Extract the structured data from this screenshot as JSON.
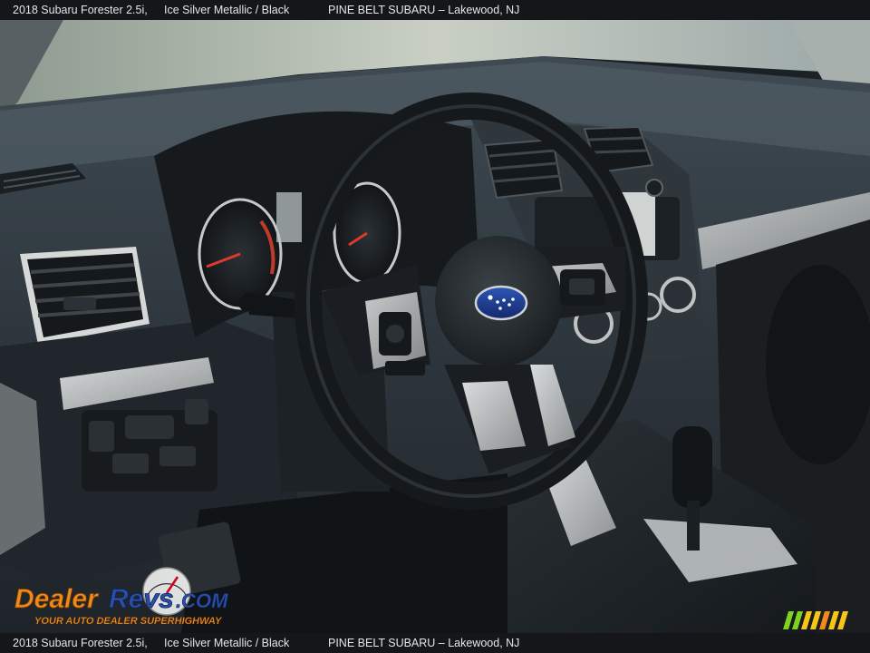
{
  "caption": {
    "model": "2018 Subaru Forester 2.5i,",
    "color": "Ice Silver Metallic / Black",
    "dealer": "PINE BELT SUBARU – Lakewood, NJ"
  },
  "watermark": {
    "brand": "DealerRevs.com",
    "tagline": "Your Auto Dealer SuperHighway"
  },
  "colors": {
    "caption_bg": "#141619",
    "caption_text": "#e6e6e6",
    "dashboard": "#2c3339",
    "trim_silver": "#b9bcbd",
    "logo_blue": "#1c3c8c",
    "watermark_orange": "#f08a1c",
    "watermark_blue": "#2b4fa8",
    "stripe_green": "#7ed321",
    "stripe_yellow": "#f5c518",
    "stripe_orange": "#f08a1c"
  }
}
